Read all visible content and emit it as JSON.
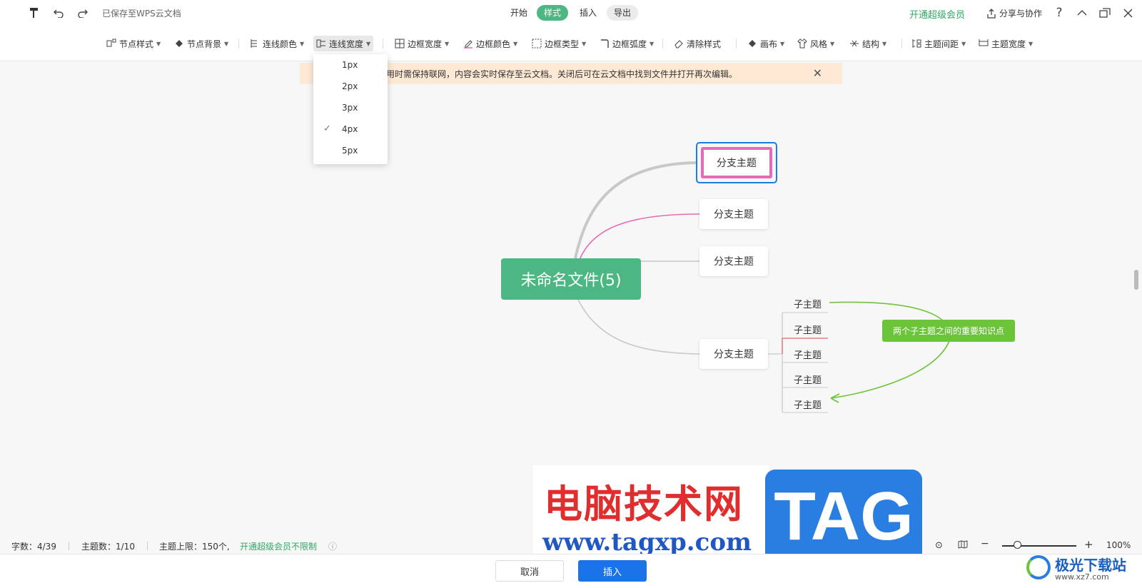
{
  "topbar": {
    "saved_status": "已保存至WPS云文档",
    "mode_tabs": [
      "开始",
      "样式",
      "插入",
      "导出"
    ],
    "vip_link": "开通超级会员",
    "share_label": "分享与协作",
    "help": "?"
  },
  "toolbar": {
    "items": [
      "节点样式",
      "节点背景",
      "连线颜色",
      "连线宽度",
      "边框宽度",
      "边框颜色",
      "边框类型",
      "边框弧度",
      "清除样式",
      "画布",
      "风格",
      "结构",
      "主题间距",
      "主题宽度"
    ]
  },
  "notice": {
    "text": "使用时需保持联网，内容会实时保存至云文档。关闭后可在云文档中找到文件并打开再次编辑。"
  },
  "line_width_dropdown": {
    "options": [
      "1px",
      "2px",
      "3px",
      "4px",
      "5px"
    ],
    "selected": "4px"
  },
  "mindmap": {
    "root": "未命名文件(5)",
    "branches": [
      "分支主题",
      "分支主题",
      "分支主题",
      "分支主题"
    ],
    "subtopics": [
      "子主题",
      "子主题",
      "子主题",
      "子主题",
      "子主题"
    ],
    "callout": "两个子主题之间的重要知识点",
    "colors": {
      "root": "#4cb782",
      "selected_border": "#e66ab4",
      "pink_line": "#e66ab4",
      "green_relation": "#6bc43a",
      "red_line": "#e03c3c"
    }
  },
  "statusbar": {
    "word_count": "字数：4/39",
    "topic_count": "主题数：1/10",
    "topic_limit": "主题上限：150个,",
    "vip_unlimited": "开通超级会员不限制",
    "zoom": "100%"
  },
  "buttons": {
    "cancel": "取消",
    "insert": "插入"
  },
  "watermarks": {
    "site_cn": "电脑技术网",
    "site_url": "www.tagxp.com",
    "tag": "TAG",
    "xz_name": "极光下载站",
    "xz_url": "www.xz7.com"
  }
}
